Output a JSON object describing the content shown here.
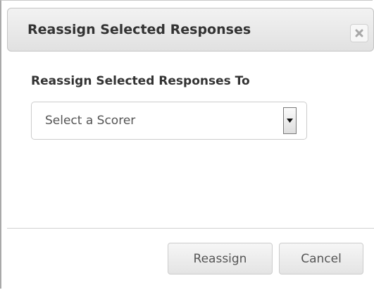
{
  "dialog": {
    "title": "Reassign Selected Responses",
    "close_icon": "close-icon"
  },
  "form": {
    "label": "Reassign Selected Responses To",
    "scorer_select": {
      "selected": "Select a Scorer",
      "arrow_icon": "caret-down-icon"
    }
  },
  "footer": {
    "reassign_label": "Reassign",
    "cancel_label": "Cancel"
  }
}
